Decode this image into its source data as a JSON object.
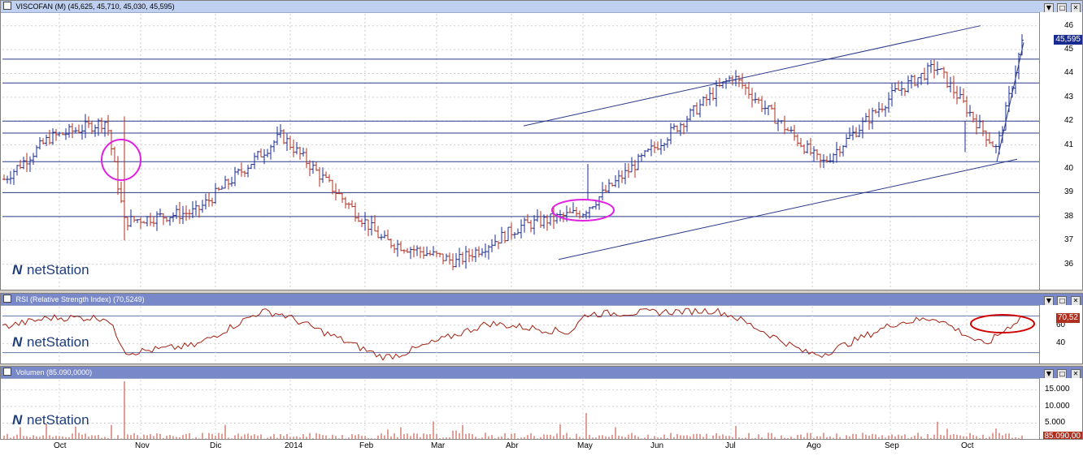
{
  "main_panel": {
    "title": "VISCOFAN (M) (45,625, 45,710, 45,030, 45,595)",
    "last_price_tag": "45,595",
    "y_ticks": [
      "46",
      "45",
      "44",
      "43",
      "42",
      "41",
      "40",
      "39",
      "38",
      "37",
      "36"
    ],
    "logo": "netStation"
  },
  "rsi_panel": {
    "title": "RSI (Relative Strength Index) (70,5249)",
    "last_value_tag": "70,52",
    "y_ticks": [
      "60",
      "40"
    ],
    "logo": "netStation"
  },
  "volume_panel": {
    "title": "Volumen (85.090,0000)",
    "last_value_tag": "85.090,00",
    "y_ticks": [
      "15.000",
      "10.000",
      "5.000"
    ],
    "logo": "netStation"
  },
  "x_axis": {
    "labels": [
      "Oct",
      "Nov",
      "Dic",
      "2014",
      "Feb",
      "Mar",
      "Abr",
      "May",
      "Jun",
      "Jul",
      "Ago",
      "Sep",
      "Oct"
    ]
  },
  "window_buttons": {
    "minimize": "▼",
    "maximize": "□",
    "close": "✕"
  },
  "colors": {
    "up_bar": "#1a2b8f",
    "down_bar": "#b03020",
    "trend_line": "#2a3a8a",
    "rsi_line": "#a02010",
    "volume_bar": "#c04030",
    "highlight_magenta": "#e020e0",
    "highlight_red": "#d00000"
  },
  "chart_data": [
    {
      "type": "bar",
      "chart_kind": "OHLC price",
      "title": "VISCOFAN (M) (45,625, 45,710, 45,030, 45,595)",
      "ylim": [
        35,
        46.5
      ],
      "x_months": [
        "Oct",
        "Nov",
        "Dic",
        "2014",
        "Feb",
        "Mar",
        "Abr",
        "May",
        "Jun",
        "Jul",
        "Ago",
        "Sep",
        "Oct"
      ],
      "close_path_by_month": [
        {
          "month": "Oct",
          "close": 41.0
        },
        {
          "month": "Oct(late)",
          "close": 42.0
        },
        {
          "month": "Nov",
          "close": 38.0
        },
        {
          "month": "Dic",
          "close": 38.2
        },
        {
          "month": "2014",
          "close": 41.4
        },
        {
          "month": "Feb",
          "close": 37.0
        },
        {
          "month": "Mar",
          "close": 36.1
        },
        {
          "month": "Abr",
          "close": 37.6
        },
        {
          "month": "May",
          "close": 40.2
        },
        {
          "month": "Jun",
          "close": 41.8
        },
        {
          "month": "Jul",
          "close": 43.9
        },
        {
          "month": "Ago",
          "close": 40.2
        },
        {
          "month": "Sep",
          "close": 42.8
        },
        {
          "month": "Sep(late)",
          "close": 44.3
        },
        {
          "month": "Oct",
          "close": 40.8
        },
        {
          "month": "Oct(end)",
          "close": 45.6
        }
      ],
      "horizontal_lines": [
        44.6,
        43.6,
        42.0,
        41.5,
        40.3,
        39.0,
        38.0
      ],
      "trend_lines": [
        {
          "from": [
            "Jun",
            41.8
          ],
          "to": [
            "Oct(end)",
            46.0
          ]
        },
        {
          "from": [
            "May",
            36.2
          ],
          "to": [
            "Oct(end)",
            40.4
          ]
        }
      ],
      "last": {
        "open": 45.625,
        "high": 45.71,
        "low": 45.03,
        "close": 45.595
      }
    },
    {
      "type": "line",
      "title": "RSI (Relative Strength Index) (70,5249)",
      "ylim": [
        20,
        80
      ],
      "last": 70.52,
      "levels": [
        70,
        30
      ]
    },
    {
      "type": "bar",
      "title": "Volumen (85.090,0000)",
      "ylim": [
        0,
        18000
      ],
      "last": 85090,
      "notable_spikes": [
        {
          "month": "Nov",
          "value": 17500
        },
        {
          "month": "May",
          "value": 8000
        }
      ]
    }
  ]
}
